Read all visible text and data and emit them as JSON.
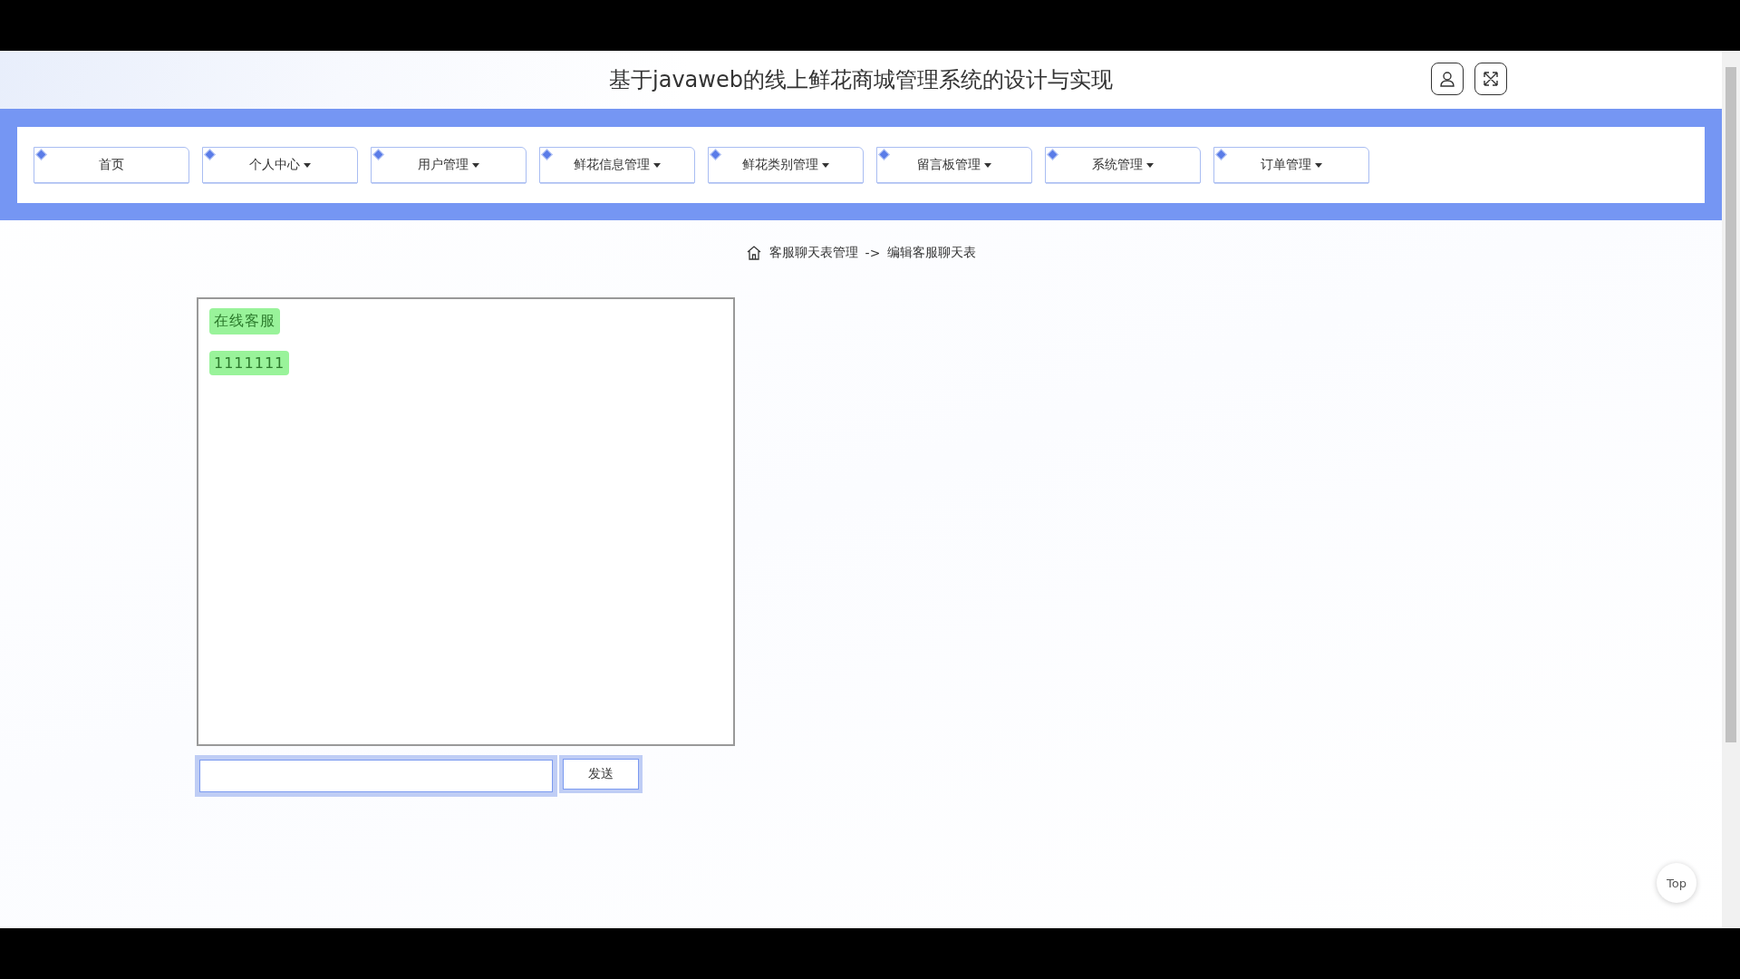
{
  "header": {
    "title": "基于javaweb的线上鲜花商城管理系统的设计与实现"
  },
  "nav": [
    {
      "label": "首页",
      "has_menu": false
    },
    {
      "label": "个人中心",
      "has_menu": true
    },
    {
      "label": "用户管理",
      "has_menu": true
    },
    {
      "label": "鲜花信息管理",
      "has_menu": true
    },
    {
      "label": "鲜花类别管理",
      "has_menu": true
    },
    {
      "label": "留言板管理",
      "has_menu": true
    },
    {
      "label": "系统管理",
      "has_menu": true
    },
    {
      "label": "订单管理",
      "has_menu": true
    }
  ],
  "breadcrumb": {
    "parent": "客服聊天表管理",
    "separator": "->",
    "current": "编辑客服聊天表"
  },
  "chat": {
    "messages": [
      {
        "text": "在线客服"
      },
      {
        "text": "1111111"
      }
    ]
  },
  "composer": {
    "send_button": "发送"
  },
  "back_to_top": "Top"
}
